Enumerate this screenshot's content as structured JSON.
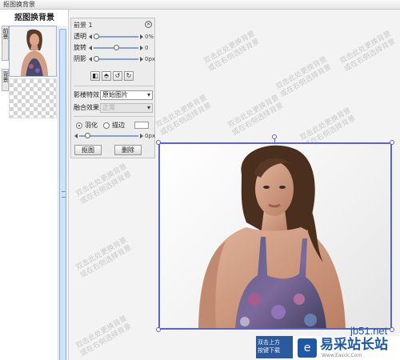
{
  "window": {
    "title": "抠图换背景"
  },
  "left_panel": {
    "header": "抠图换背景",
    "layer_tabs": [
      "前景",
      "背景"
    ]
  },
  "control_panel": {
    "title": "前景 1",
    "sliders": [
      {
        "label": "透明",
        "value_text": "0%",
        "level_pct": 0
      },
      {
        "label": "旋转",
        "value_text": "0",
        "level_pct": 50
      },
      {
        "label": "阴影",
        "value_text": "0px",
        "level_pct": 0
      }
    ],
    "image_effect": {
      "label": "影楼特效",
      "value": "原始图片"
    },
    "blend_effect": {
      "label": "融合效果",
      "value": "正常",
      "disabled": true
    },
    "feather": {
      "label": "羽化",
      "selected": true
    },
    "stroke": {
      "label": "描边",
      "selected": false
    },
    "feather_slider": {
      "value_text": "0px",
      "level_pct": 0
    },
    "buttons": {
      "cutout": "抠图",
      "delete": "删除"
    },
    "tool_icons": [
      "flip-horizontal-icon",
      "flip-vertical-icon",
      "rotate-left-icon",
      "rotate-right-icon"
    ]
  },
  "canvas": {
    "watermark_lines": [
      "双击此处更换背景",
      "或在右侧选择背景"
    ]
  },
  "tooltip": {
    "lines": [
      "双击上方",
      "按键下载"
    ]
  },
  "logo": {
    "url_text": "jb51.net",
    "brand": "易采站长站",
    "sub": "Www.Easck.Com"
  },
  "colors": {
    "selection": "#5c63c9",
    "brand": "#1d57a8",
    "scroll": "#cfe2fb"
  }
}
